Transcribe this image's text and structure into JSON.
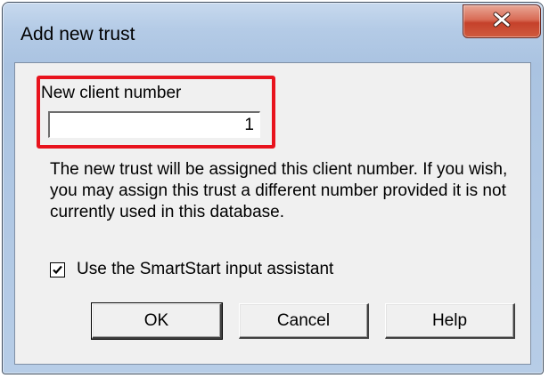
{
  "window": {
    "title": "Add new trust",
    "close_icon": "close-icon"
  },
  "client_number": {
    "label": "New client number",
    "value": "1"
  },
  "description": "The new trust will be assigned this client number. If you wish, you may assign this trust a different number provided it is not currently used in this database.",
  "smartstart": {
    "label": "Use the SmartStart input assistant",
    "checked": true
  },
  "buttons": {
    "ok": "OK",
    "cancel": "Cancel",
    "help": "Help"
  },
  "colors": {
    "highlight": "#e8131d",
    "close_button": "#c5412b",
    "dialog_background": "#f0f0f0"
  }
}
